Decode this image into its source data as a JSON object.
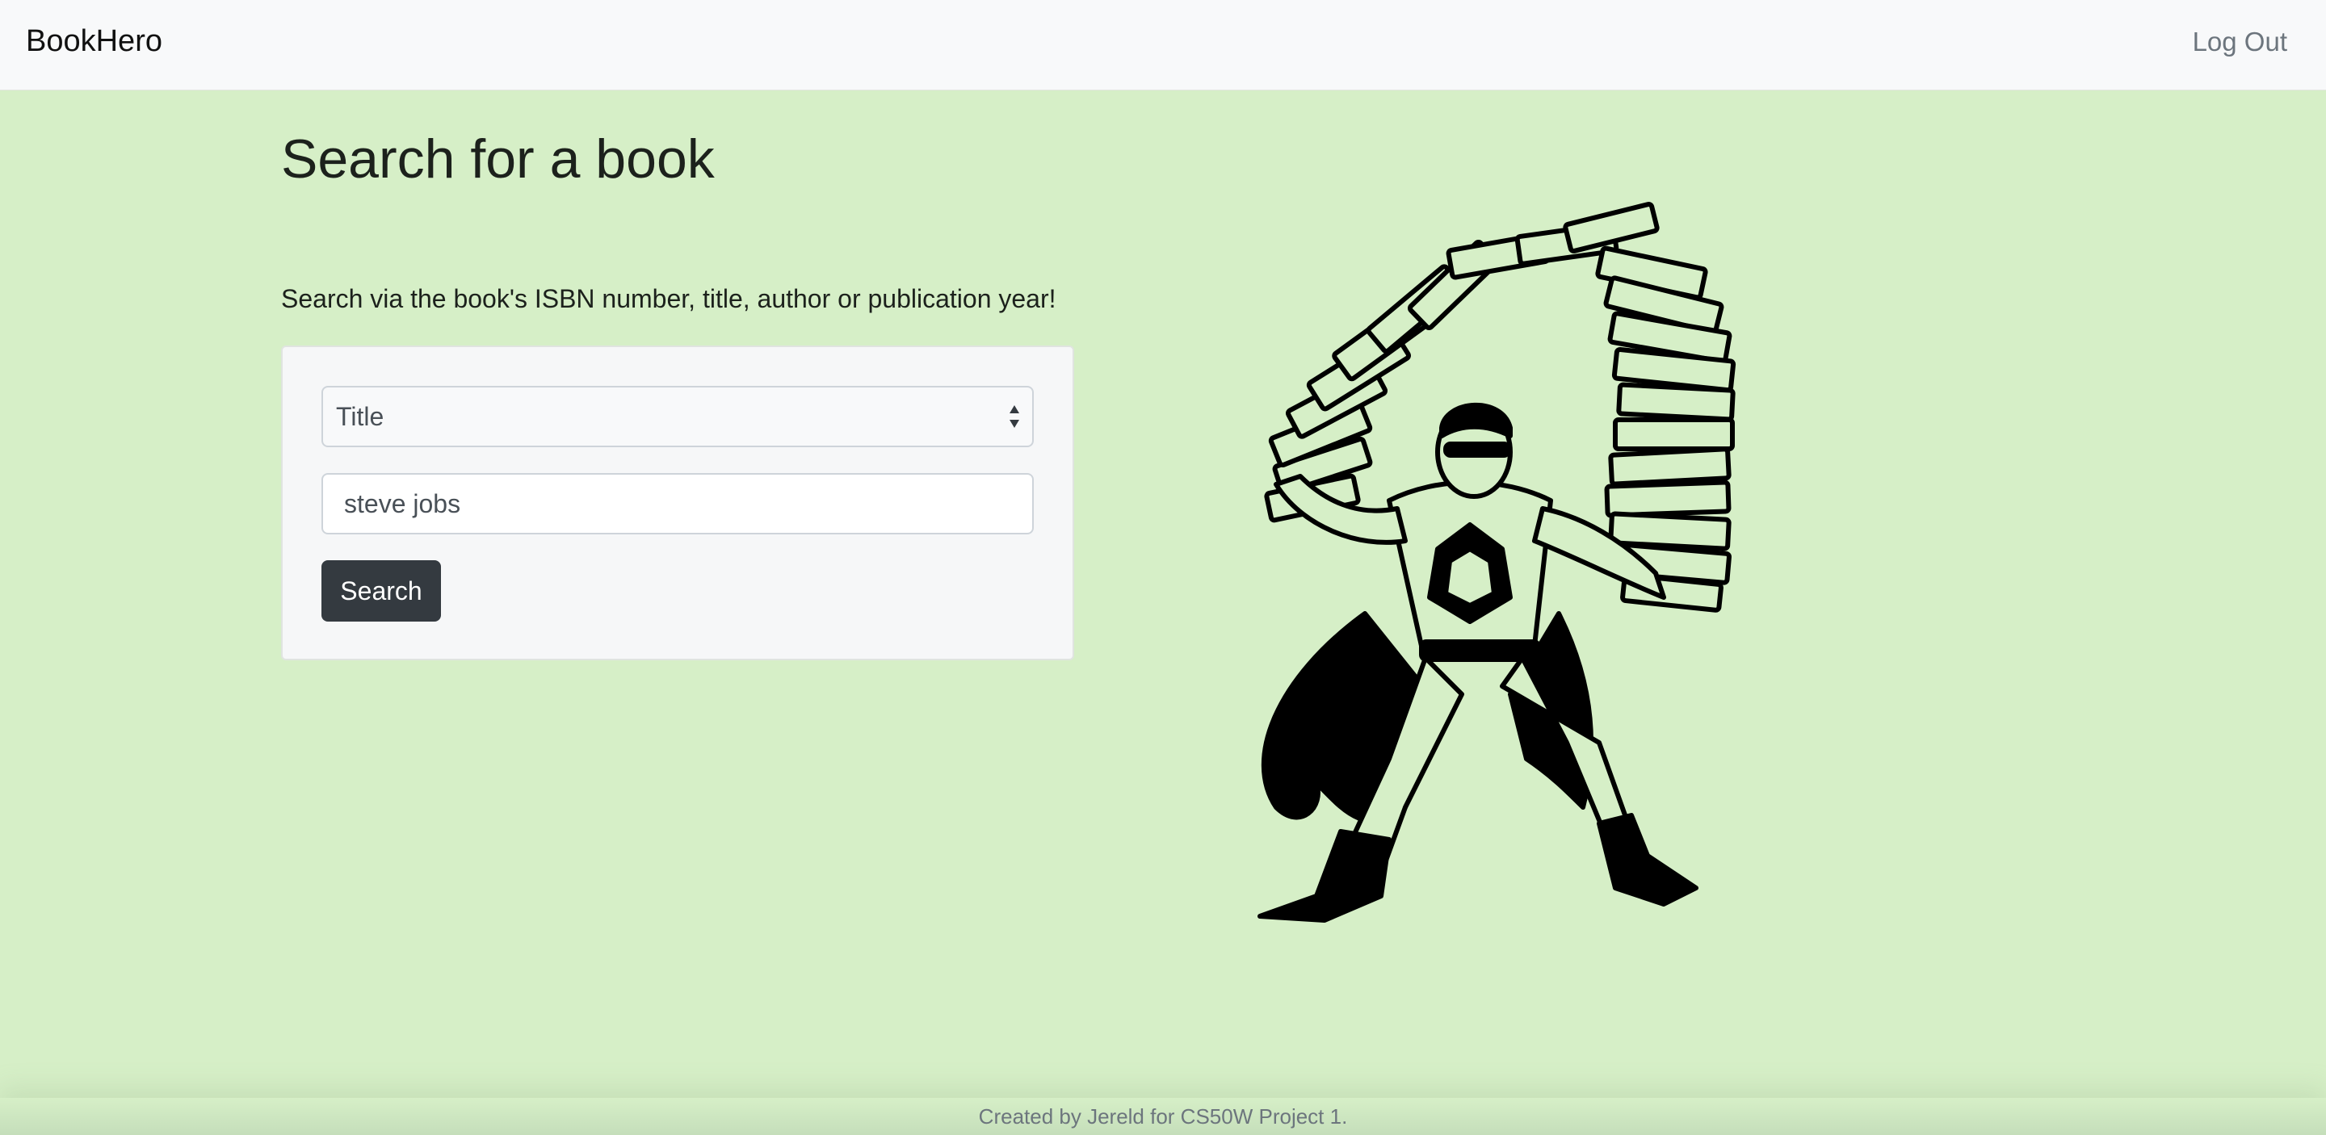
{
  "navbar": {
    "brand": "BookHero",
    "logout": "Log Out"
  },
  "main": {
    "title": "Search for a book",
    "subtitle": "Search via the book's ISBN number, title, author or publication year!"
  },
  "search": {
    "field_selected": "Title",
    "query_value": "steve jobs",
    "button_label": "Search"
  },
  "illustration": {
    "icon": "superhero-books-illustration"
  },
  "footer": {
    "text": "Created by Jereld for CS50W Project 1."
  },
  "colors": {
    "page_background": "#d6efc7",
    "navbar_background": "#f8f9fa",
    "button_background": "#343a40"
  }
}
